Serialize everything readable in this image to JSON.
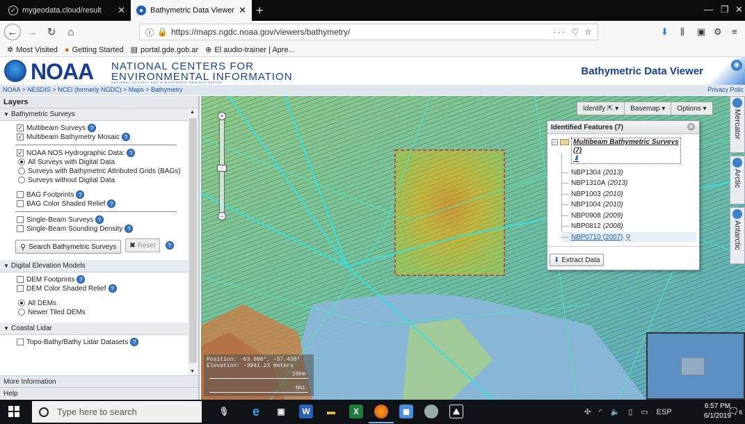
{
  "browser": {
    "tabs": [
      {
        "label": "mygeodata.cloud/result",
        "active": false
      },
      {
        "label": "Bathymetric Data Viewer",
        "active": true
      }
    ],
    "url": "https://maps.ngdc.noaa.gov/viewers/bathymetry/",
    "url_host_bold": "noaa.gov",
    "url_right": "···",
    "bookmarks": [
      "Most Visited",
      "Getting Started",
      "portal.gde.gob.ar",
      "El audio-trainer | Apre..."
    ]
  },
  "header": {
    "logo_text": "NOAA",
    "org_line1": "NATIONAL CENTERS FOR",
    "org_line2": "ENVIRONMENTAL INFORMATION",
    "org_sub": "NATIONAL OCEANIC AND ATMOSPHERIC ADMINISTRATION",
    "app_title": "Bathymetric Data Viewer"
  },
  "breadcrumb": "NOAA > NESDIS > NCEI (formerly NGDC) > Maps > Bathymetry",
  "privacy_label": "Privacy Polic",
  "layers_panel": {
    "title": "Layers",
    "bathymetric": {
      "heading": "Bathymetric Surveys",
      "multibeam_surveys": "Multibeam Surveys",
      "multibeam_mosaic": "Multibeam Bathymetry Mosaic",
      "nos_data": "NOAA NOS Hydrographic Data:",
      "opt_all": "All Surveys with Digital Data",
      "opt_bags": "Surveys with Bathymetric Attributed Grids (BAGs)",
      "opt_without": "Surveys without Digital Data",
      "bag_footprints": "BAG Footprints",
      "bag_relief": "BAG Color Shaded Relief",
      "single_beam": "Single-Beam Surveys",
      "single_density": "Single-Beam Sounding Density",
      "search_button": "Search Bathymetric Surveys",
      "reset_button": "Reset"
    },
    "dem": {
      "heading": "Digital Elevation Models",
      "footprints": "DEM Footprints",
      "relief": "DEM Color Shaded Relief",
      "opt_all": "All DEMs",
      "opt_newer": "Newer Tiled DEMs"
    },
    "lidar": {
      "heading": "Coastal Lidar",
      "datasets": "Topo-Bathy/Bathy Lidar Datasets"
    },
    "more_info": "More Information",
    "help": "Help"
  },
  "map_toolbar": {
    "identify": "Identify",
    "basemap": "Basemap",
    "options": "Options"
  },
  "projection_tabs": [
    "Mercator",
    "Arctic",
    "Antarctic"
  ],
  "coords": {
    "position": "Position: -63.998°, -57.438°",
    "elevation": "Elevation: -3941.23 meters",
    "scale_km": "10km",
    "scale_mi": "6mi"
  },
  "identified": {
    "title": "Identified Features (7)",
    "group": "Multibeam Bathymetric Surveys (7)",
    "items": [
      {
        "name": "NBP1304",
        "year": "(2013)"
      },
      {
        "name": "NBP1310A",
        "year": "(2013)"
      },
      {
        "name": "NBP1003",
        "year": "(2010)"
      },
      {
        "name": "NBP1004",
        "year": "(2010)"
      },
      {
        "name": "NBP0908",
        "year": "(2009)"
      },
      {
        "name": "NBP0812",
        "year": "(2008)"
      },
      {
        "name": "NBP0710 (2007)",
        "year": ""
      }
    ],
    "extract_button": "Extract Data"
  },
  "taskbar": {
    "search_placeholder": "Type here to search",
    "lang": "ESP",
    "time": "6:57 PM",
    "date": "6/1/2019",
    "notifications": "6"
  },
  "colors": {
    "accent": "#1a3e8c",
    "selection_box": "#cc2a2a",
    "track_line": "#33e0e0"
  }
}
